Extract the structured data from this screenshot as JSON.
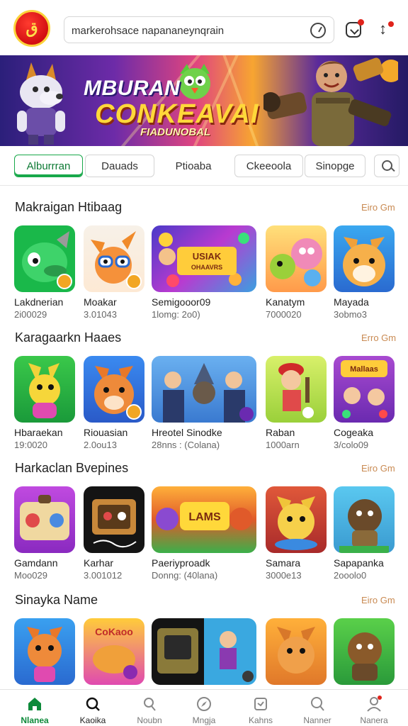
{
  "search": {
    "value": "markerohsace napananeynqrain"
  },
  "banner": {
    "title": "MBURAN",
    "subtitle": "CONKEAVAI",
    "tagline": "FIADUNOBAL"
  },
  "tabs": [
    {
      "label": "Alburrran",
      "active": true
    },
    {
      "label": "Dauads"
    },
    {
      "label": "Ptioaba"
    },
    {
      "label": "Ckeeoola"
    },
    {
      "label": "Sinopge"
    }
  ],
  "sections": [
    {
      "title": "Makraigan Htibaag",
      "more": "Eiro Gm",
      "items": [
        {
          "name": "Lakdnerian",
          "meta": "2i00029"
        },
        {
          "name": "Moakar",
          "meta": "3.01043"
        },
        {
          "name": "Semigooor09",
          "meta": "1lomg: 2o0)"
        },
        {
          "name": "Kanatym",
          "meta": "7000020"
        },
        {
          "name": "Mayada",
          "meta": "3obmo3"
        }
      ]
    },
    {
      "title": "Karagaarkn Haaes",
      "more": "Erro Gm",
      "items": [
        {
          "name": "Hbaraekan",
          "meta": "19:0020"
        },
        {
          "name": "Riouasian",
          "meta": "2.0ou13"
        },
        {
          "name": "Hreotel Sinodke",
          "meta": "28nns : (Colana)"
        },
        {
          "name": "Raban",
          "meta": "1000arn"
        },
        {
          "name": "Cogeaka",
          "meta": "3/colo09"
        }
      ]
    },
    {
      "title": "Harkaclan Bvepines",
      "more": "Eiro Gm",
      "items": [
        {
          "name": "Gamdann",
          "meta": "Moo029"
        },
        {
          "name": "Karhar",
          "meta": "3.001012"
        },
        {
          "name": "Paeriyproadk",
          "meta": "Donng: (40lana)"
        },
        {
          "name": "Samara",
          "meta": "3000e13"
        },
        {
          "name": "Sapapanka",
          "meta": "2ooolo0"
        }
      ]
    },
    {
      "title": "Sinayka Name",
      "more": "Eiro Gm",
      "items": [
        {},
        {},
        {},
        {},
        {}
      ]
    }
  ],
  "nav": [
    {
      "label": "Nlanea",
      "icon": "home-icon",
      "active": true
    },
    {
      "label": "Kaoika",
      "icon": "search-icon"
    },
    {
      "label": "Noubn",
      "icon": "search-outline-icon"
    },
    {
      "label": "Mngja",
      "icon": "compass-icon"
    },
    {
      "label": "Kahns",
      "icon": "card-icon"
    },
    {
      "label": "Nanner",
      "icon": "search-alt-icon"
    },
    {
      "label": "Nanera",
      "icon": "profile-icon"
    }
  ],
  "colors": {
    "accent": "#18a84a",
    "more_link": "#c98a52",
    "badge_red": "#e0231b"
  }
}
